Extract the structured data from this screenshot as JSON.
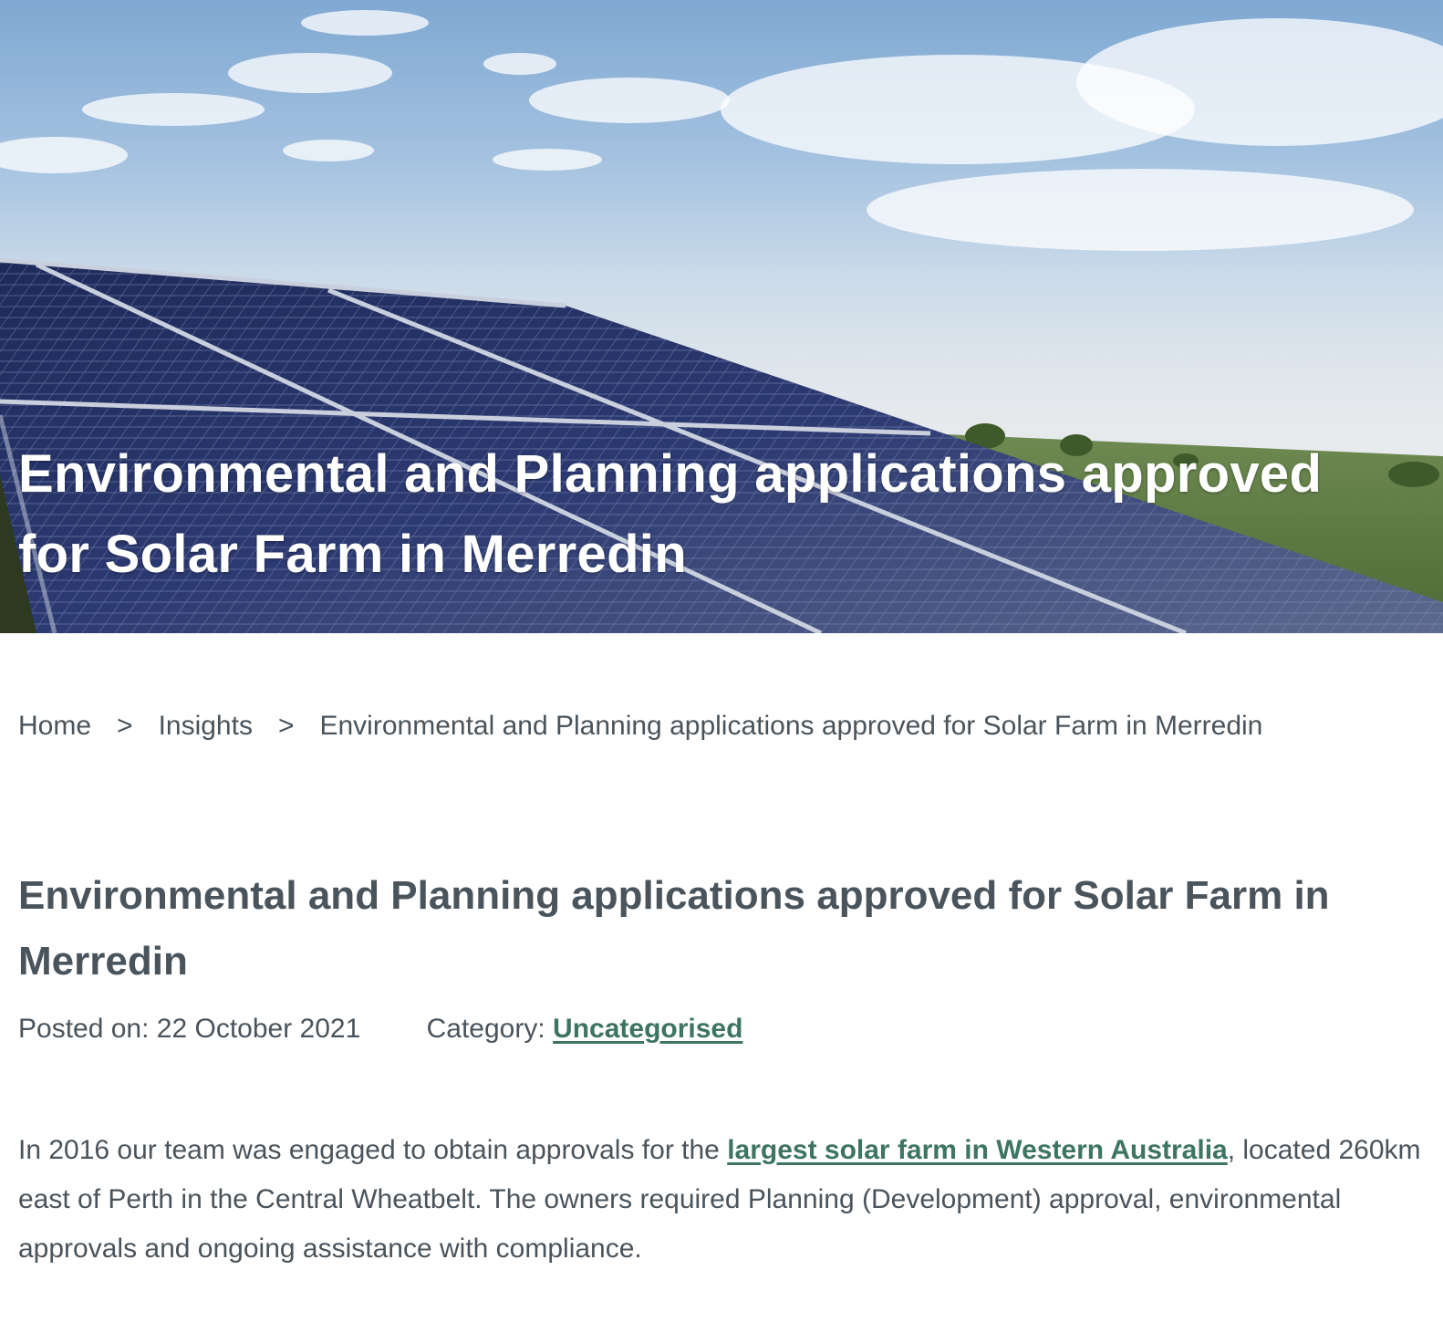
{
  "hero": {
    "title": "Environmental and Planning applications approved for Solar Farm in Merredin"
  },
  "breadcrumb": {
    "items": [
      {
        "label": "Home"
      },
      {
        "label": "Insights"
      },
      {
        "label": "Environmental and Planning applications approved for Solar Farm in Merredin"
      }
    ],
    "separator": ">"
  },
  "article": {
    "title": "Environmental and Planning applications approved for Solar Farm in Merredin",
    "posted_label": "Posted on:",
    "posted_date": "22 October 2021",
    "category_label": "Category:",
    "category_value": "Uncategorised",
    "body": {
      "before_link": "In 2016 our team was engaged to obtain approvals for the ",
      "link_text": "largest solar farm in Western Australia",
      "after_link": ", located 260km east of Perth in the Central Wheatbelt. The owners required Planning (Development) approval, environmental approvals and ongoing assistance with compliance."
    }
  },
  "colors": {
    "text": "#4a545c",
    "link": "#3e7464",
    "hero_text": "#ffffff"
  }
}
